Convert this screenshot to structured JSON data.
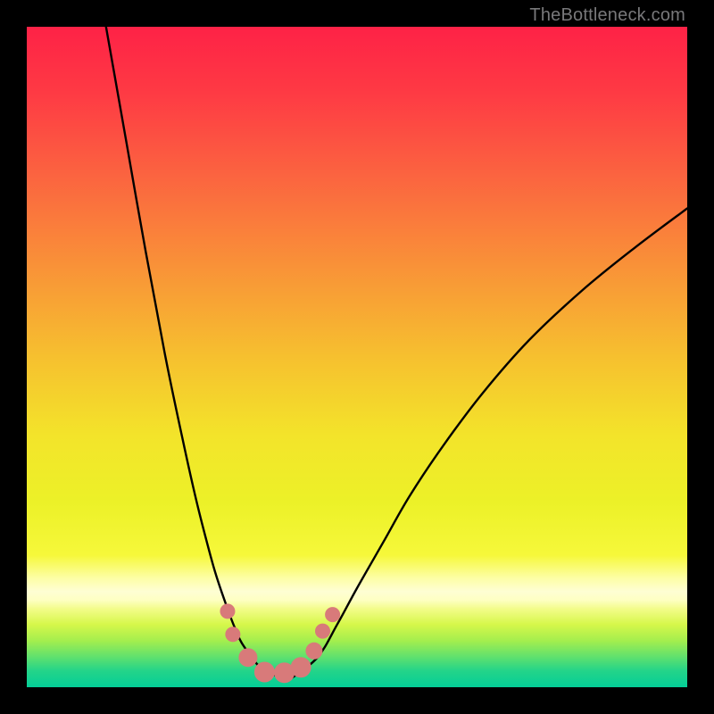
{
  "watermark": "TheBottleneck.com",
  "colors": {
    "frame": "#000000",
    "curve": "#000000",
    "marker_fill": "#d87a7a",
    "marker_stroke": "#d87a7a"
  },
  "gradient_stops": [
    {
      "offset": 0.0,
      "color": "#fe2246"
    },
    {
      "offset": 0.1,
      "color": "#fe3a44"
    },
    {
      "offset": 0.22,
      "color": "#fb6240"
    },
    {
      "offset": 0.36,
      "color": "#f99138"
    },
    {
      "offset": 0.5,
      "color": "#f6c02f"
    },
    {
      "offset": 0.62,
      "color": "#f3e42a"
    },
    {
      "offset": 0.72,
      "color": "#ecf128"
    },
    {
      "offset": 0.8,
      "color": "#f6f83a"
    },
    {
      "offset": 0.835,
      "color": "#fdfea6"
    },
    {
      "offset": 0.855,
      "color": "#fefed4"
    },
    {
      "offset": 0.868,
      "color": "#feffc2"
    },
    {
      "offset": 0.882,
      "color": "#f2fc88"
    },
    {
      "offset": 0.905,
      "color": "#d6f74a"
    },
    {
      "offset": 0.93,
      "color": "#a3ee4e"
    },
    {
      "offset": 0.955,
      "color": "#5de06f"
    },
    {
      "offset": 0.975,
      "color": "#24d489"
    },
    {
      "offset": 1.0,
      "color": "#04ce97"
    }
  ],
  "chart_data": {
    "type": "line",
    "title": "",
    "xlabel": "",
    "ylabel": "",
    "xlim": [
      0,
      100
    ],
    "ylim": [
      0,
      100
    ],
    "legend": false,
    "grid": false,
    "annotations": [
      "TheBottleneck.com"
    ],
    "series": [
      {
        "name": "left-curve",
        "x": [
          12.0,
          15.0,
          18.0,
          21.0,
          23.5,
          25.5,
          27.0,
          28.5,
          30.0,
          31.5,
          33.0,
          36.0,
          40.0
        ],
        "y": [
          100.0,
          83.0,
          66.0,
          50.0,
          38.0,
          29.0,
          23.0,
          17.5,
          13.0,
          9.0,
          6.0,
          2.5,
          1.3
        ]
      },
      {
        "name": "right-curve",
        "x": [
          40.0,
          44.0,
          47.0,
          50.0,
          54.0,
          58.0,
          63.0,
          69.0,
          76.0,
          84.0,
          92.0,
          100.0
        ],
        "y": [
          1.3,
          4.5,
          9.5,
          15.0,
          22.0,
          29.0,
          36.5,
          44.5,
          52.5,
          60.0,
          66.5,
          72.5
        ]
      }
    ],
    "markers": {
      "name": "highlight-dots",
      "x": [
        30.4,
        31.2,
        33.5,
        36.0,
        39.0,
        41.5,
        43.5,
        44.8,
        46.3
      ],
      "y": [
        11.5,
        8.0,
        4.5,
        2.3,
        2.2,
        3.0,
        5.5,
        8.5,
        11.0
      ],
      "r": [
        8,
        8,
        10,
        11,
        11,
        11,
        9,
        8,
        8
      ]
    }
  }
}
